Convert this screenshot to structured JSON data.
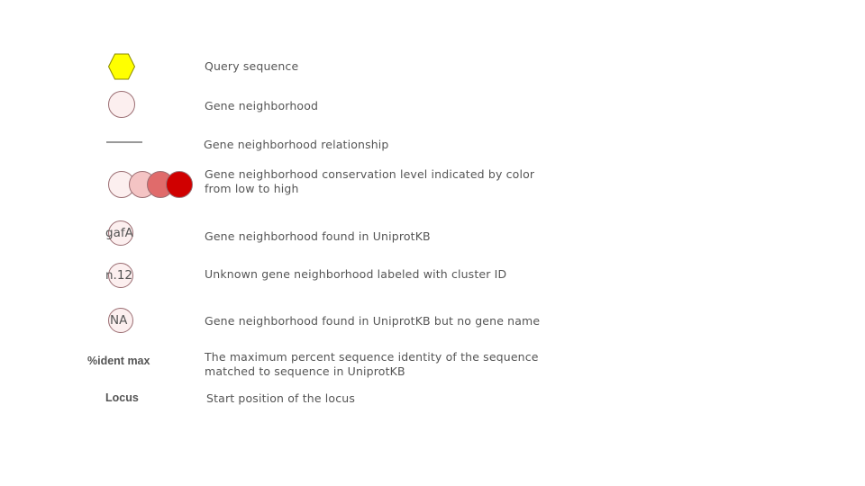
{
  "colors": {
    "query_fill": "#ffff00",
    "query_stroke": "#8a8a00",
    "neighborhood_fill": "#fcefef",
    "circle_stroke": "#9b6e73",
    "relationship_line": "#999999",
    "conservation_scale": [
      "#fcefef",
      "#f4c4c4",
      "#e06b6b",
      "#d00000"
    ]
  },
  "legend": [
    {
      "symbol": "yellow-hexagon",
      "description": "Query sequence"
    },
    {
      "symbol": "pink-circle",
      "description": "Gene neighborhood"
    },
    {
      "symbol": "gray-line",
      "description": "Gene neighborhood relationship"
    },
    {
      "symbol": "color-gradient-circles",
      "description": "Gene neighborhood conservation level indicated by color from low to high"
    },
    {
      "symbol": "labeled-circle",
      "symbol_label": "gafA",
      "description": "Gene neighborhood found in UniprotKB"
    },
    {
      "symbol": "labeled-circle",
      "symbol_label": "n.12",
      "description": "Unknown gene neighborhood labeled with cluster ID"
    },
    {
      "symbol": "labeled-circle",
      "symbol_label": "NA",
      "description": "Gene neighborhood found in UniprotKB but no gene name"
    },
    {
      "symbol": "term",
      "symbol_label": "%ident max",
      "description": "The maximum percent sequence identity of the sequence matched to sequence in UniprotKB"
    },
    {
      "symbol": "term",
      "symbol_label": "Locus",
      "description": "Start position of the locus"
    }
  ]
}
